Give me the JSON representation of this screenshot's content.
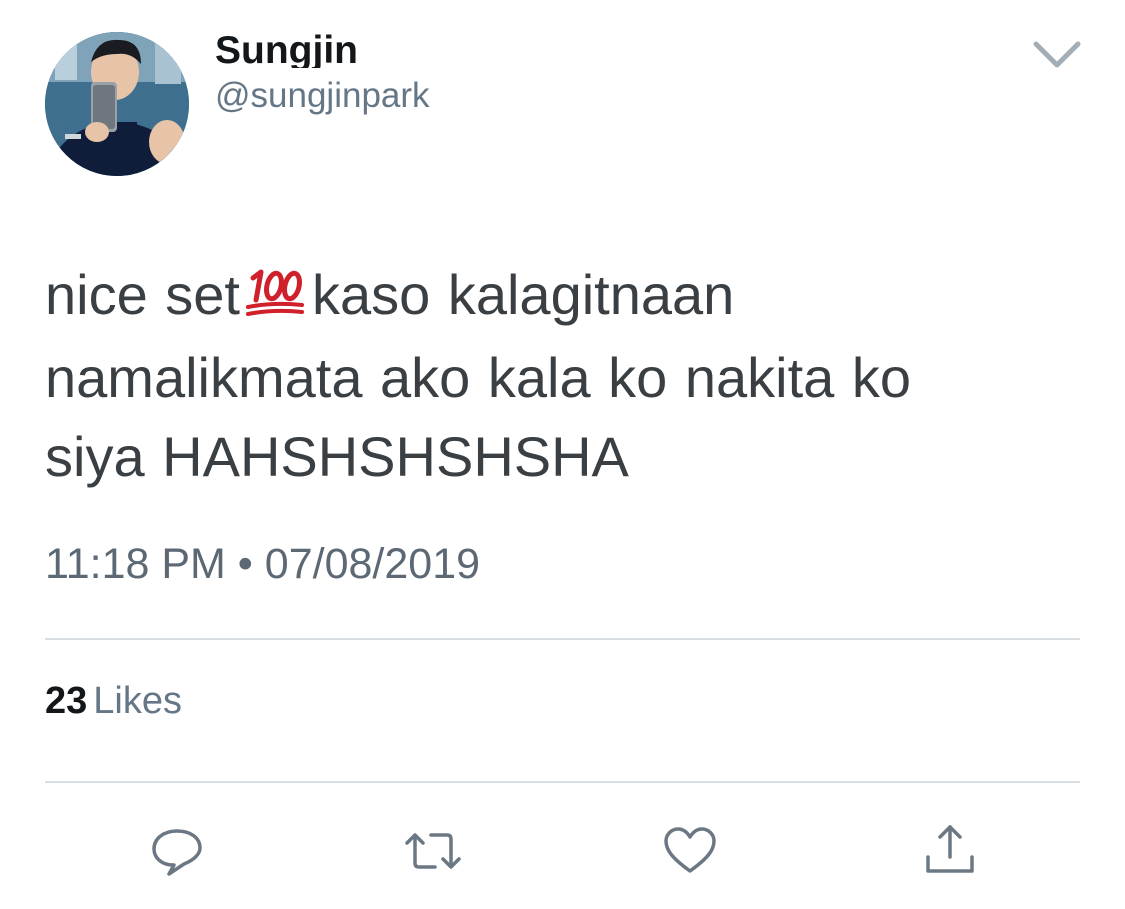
{
  "tweet": {
    "author": {
      "display_name": "Sungjin",
      "handle": "@sungjinpark"
    },
    "text_lines": [
      [
        "nice set",
        "kaso kalagitnaan"
      ],
      "namalikmata ako kala ko nakita ko",
      "siya HAHSHSHSHSHA"
    ],
    "emoji": "hundred-points-emoji",
    "timestamp": "11:18 PM • 07/08/2019",
    "likes": {
      "count": "23",
      "label": "Likes"
    },
    "actions": [
      {
        "icon": "reply-icon"
      },
      {
        "icon": "retweet-icon"
      },
      {
        "icon": "heart-icon"
      },
      {
        "icon": "share-icon"
      }
    ],
    "colors": {
      "name": "#14171a",
      "secondary": "#657786",
      "text": "#3a3f44",
      "divider": "#d8dde1",
      "emoji_red": "#d0202b"
    }
  }
}
